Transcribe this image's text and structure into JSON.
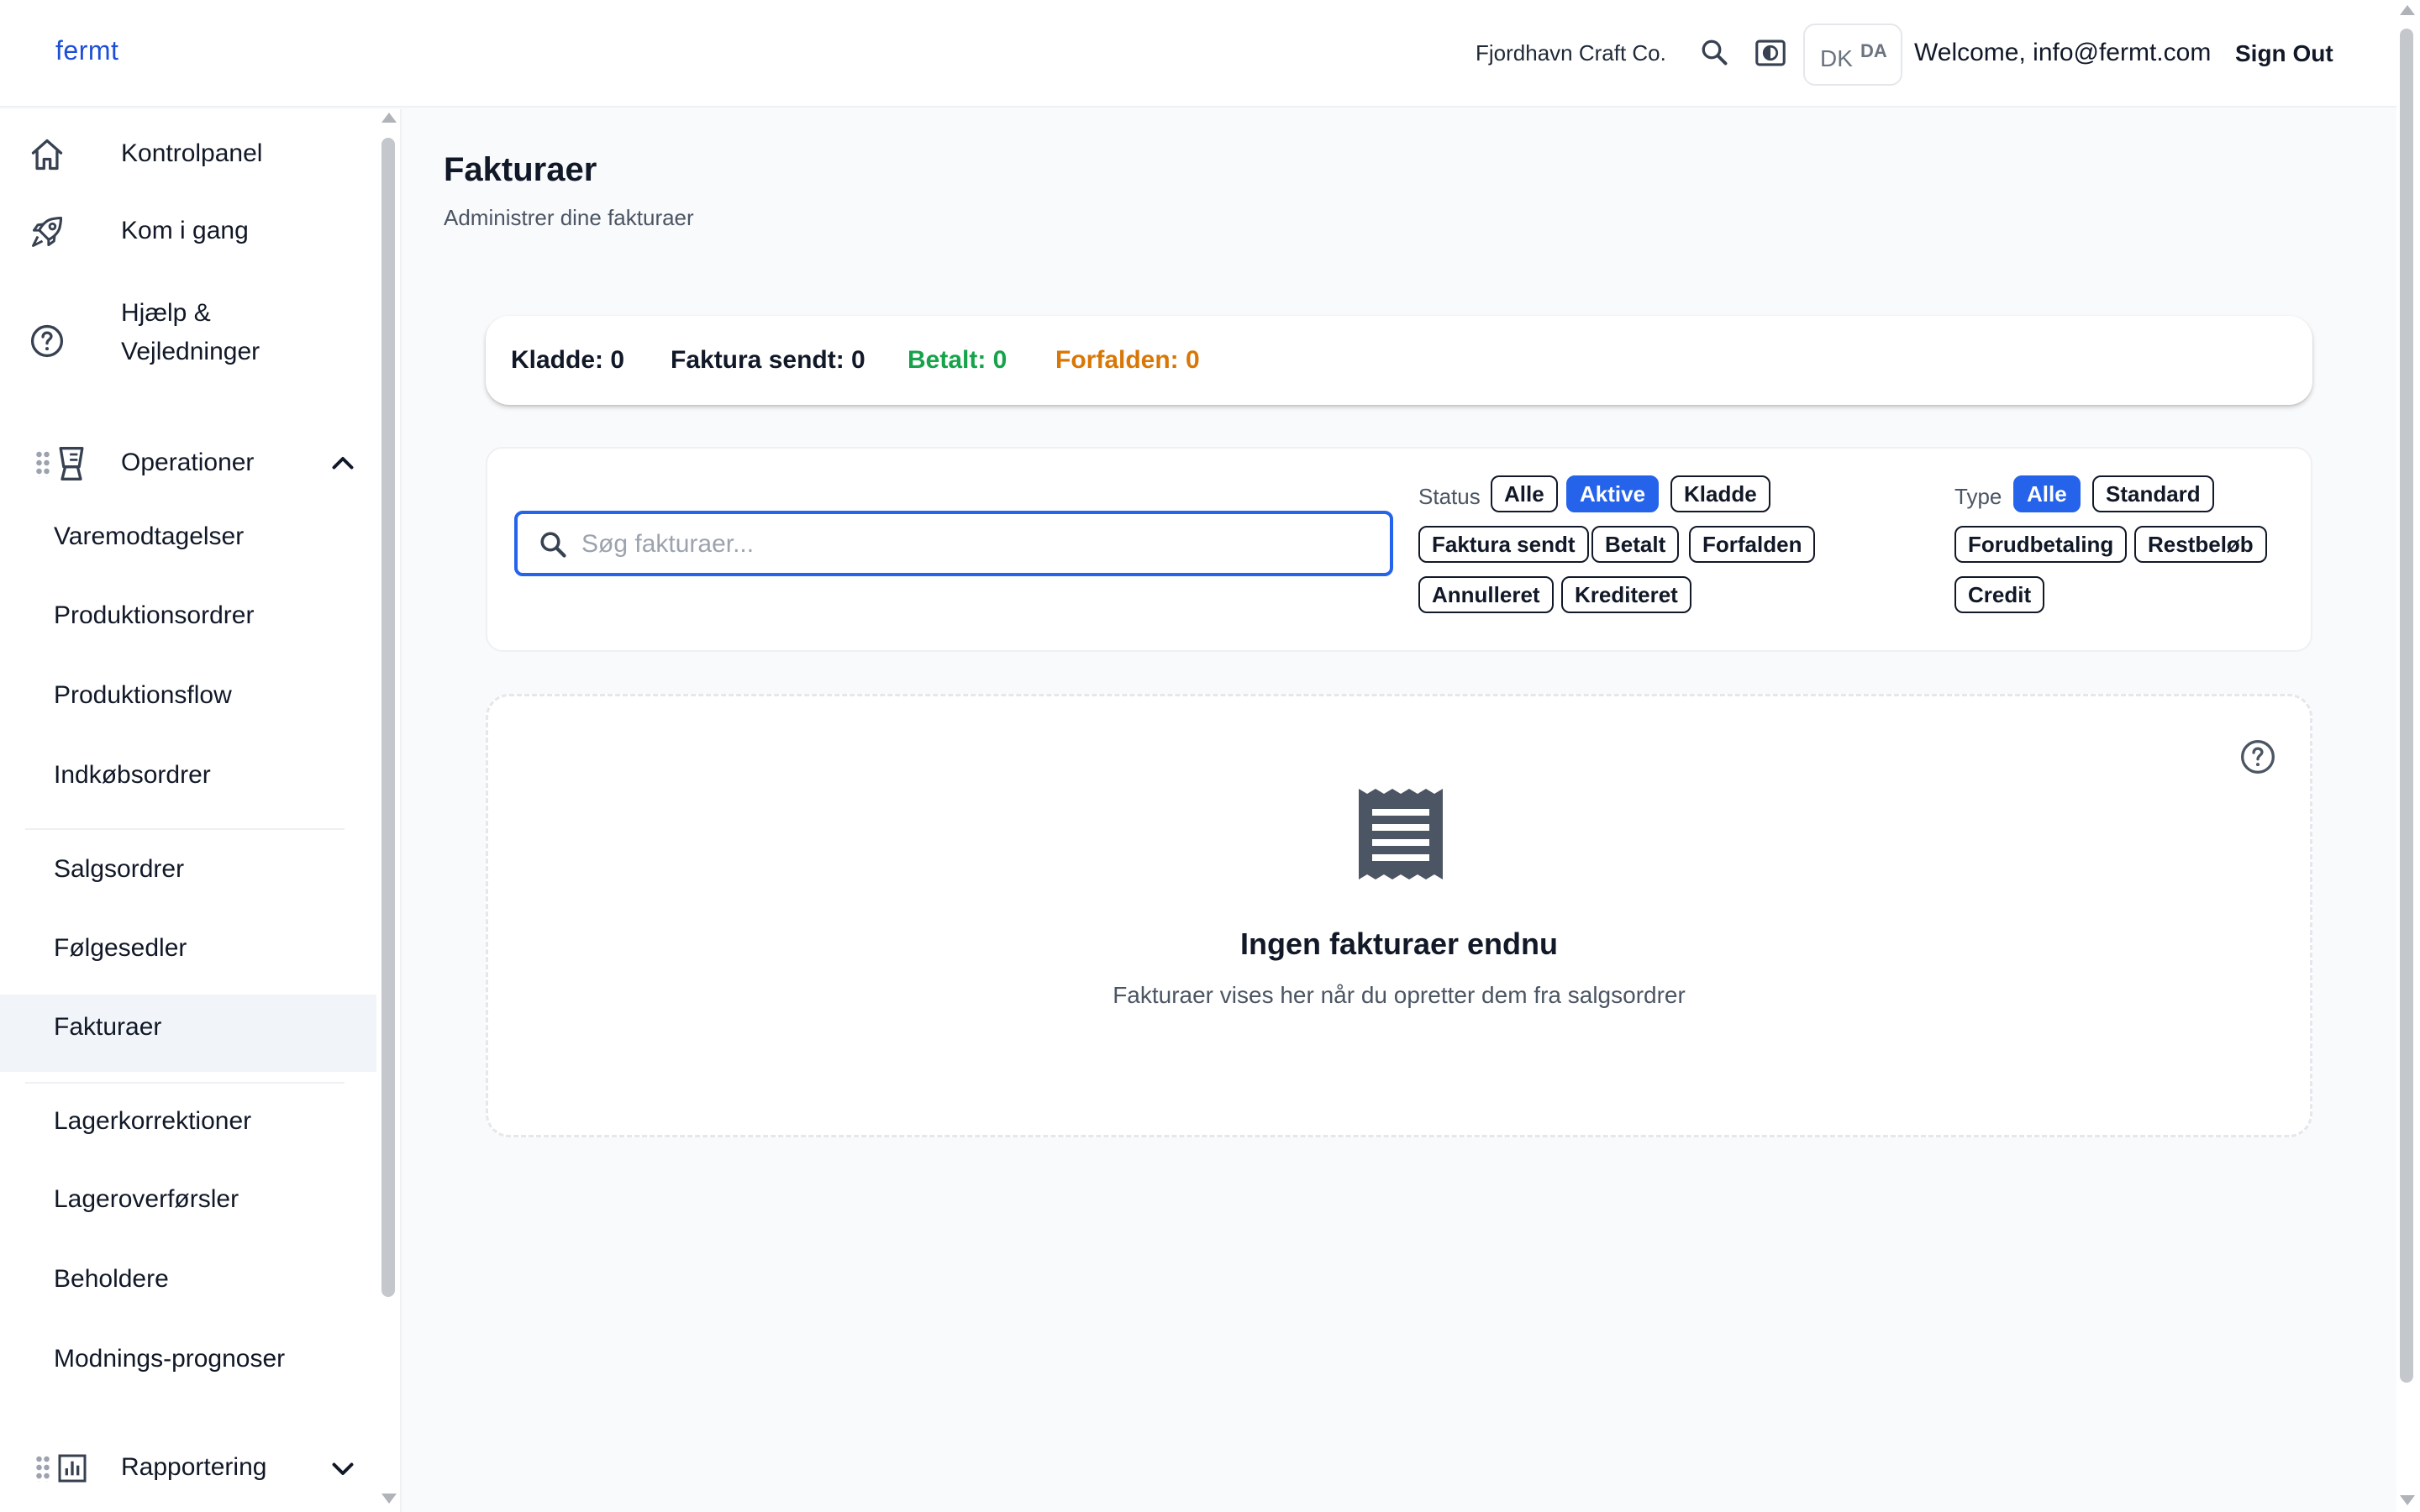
{
  "header": {
    "brand": "fermt",
    "company": "Fjordhavn Craft Co.",
    "lang_flag": "DK",
    "lang_code": "DA",
    "welcome": "Welcome, info@fermt.com",
    "sign_out": "Sign Out"
  },
  "sidebar": {
    "top_items": [
      {
        "label": "Kontrolpanel",
        "icon": "home-icon"
      },
      {
        "label": "Kom i gang",
        "icon": "rocket-icon"
      },
      {
        "label": "Hjælp & Vejledninger",
        "icon": "help-circle-icon"
      }
    ],
    "operations": {
      "label": "Operationer",
      "icon": "blender-icon",
      "expanded": true
    },
    "sub_items": [
      "Varemodtagelser",
      "Produktionsordrer",
      "Produktionsflow",
      "Indkøbsordrer",
      "Salgsordrer",
      "Følgesedler",
      "Fakturaer",
      "Lagerkorrektioner",
      "Lageroverførsler",
      "Beholdere",
      "Modnings-prognoser"
    ],
    "active_item": "Fakturaer",
    "reporting": {
      "label": "Rapportering",
      "icon": "bar-chart-icon",
      "expanded": false
    }
  },
  "main": {
    "title": "Fakturaer",
    "subtitle": "Administrer dine fakturaer",
    "stats": [
      {
        "label": "Kladde: 0",
        "color": "#111827"
      },
      {
        "label": "Faktura sendt: 0",
        "color": "#111827"
      },
      {
        "label": "Betalt: 0",
        "color": "#16a34a"
      },
      {
        "label": "Forfalden: 0",
        "color": "#d97706"
      }
    ],
    "search": {
      "placeholder": "Søg fakturaer...",
      "value": ""
    },
    "status_filter": {
      "label": "Status",
      "options": [
        "Alle",
        "Aktive",
        "Kladde",
        "Faktura sendt",
        "Betalt",
        "Forfalden",
        "Annulleret",
        "Krediteret"
      ],
      "selected": "Aktive"
    },
    "type_filter": {
      "label": "Type",
      "options": [
        "Alle",
        "Standard",
        "Forudbetaling",
        "Restbeløb",
        "Credit"
      ],
      "selected": "Alle"
    },
    "empty_state": {
      "icon": "receipt-icon",
      "title": "Ingen fakturaer endnu",
      "subtitle": "Fakturaer vises her når du opretter dem fra salgsordrer"
    }
  },
  "colors": {
    "accent": "#2563eb",
    "brand": "#1d4ed8",
    "paid": "#16a34a",
    "overdue": "#d97706"
  }
}
